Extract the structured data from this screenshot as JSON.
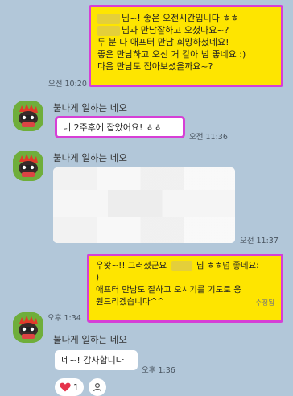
{
  "messages": {
    "m1": {
      "lines": [
        "님~! 좋은 오전시간입니다 ㅎㅎ",
        "님과 만남잘하고 오셨나요~?",
        "두 분 다 애프터 만남 희망하셨네요!",
        "좋은 만남하고 오신 거 같아 넘 좋네요  :)",
        "다음 만남도 잡아보셨을까요~?"
      ],
      "time": "오전 10:20"
    },
    "m2": {
      "sender": "불나게 일하는 네오",
      "text": "네 2주후에 잡았어요! ㅎㅎ",
      "time": "오전 11:36"
    },
    "m3": {
      "sender": "불나게 일하는 네오",
      "time": "오전 11:37"
    },
    "m4": {
      "lines": [
        "우왓~!! 그러셨군요",
        "님 ㅎㅎ넘 좋네요:",
        ")",
        "애프터 만남도 잘하고 오시기를 기도로 응",
        "원드리겠습니다^^"
      ],
      "edited": "수정됨",
      "time": "오후 1:34"
    },
    "m5": {
      "sender": "불나게 일하는 네오",
      "text": "네~! 감사합니다",
      "time": "오후 1:36",
      "reaction_count": "1"
    }
  },
  "colors": {
    "background": "#b2c7d9",
    "outgoing": "#fee500",
    "highlight": "#d63fd6",
    "heart": "#e5334b"
  },
  "icons": {
    "heart": "heart-icon",
    "add_reaction": "person-icon"
  }
}
